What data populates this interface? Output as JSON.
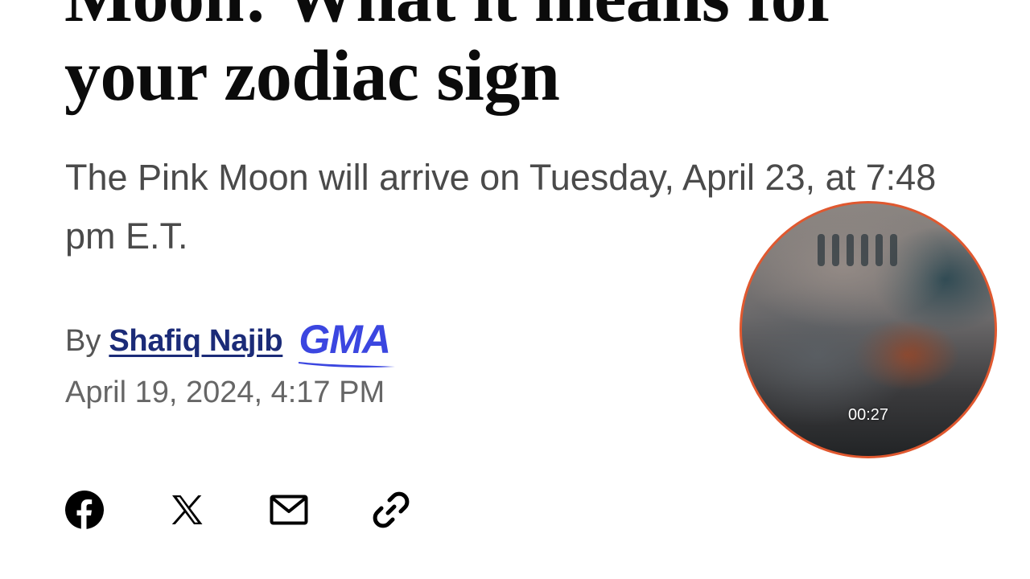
{
  "article": {
    "headline_lines": [
      "Moon: What it means for",
      "your zodiac sign"
    ],
    "subheadline": "The Pink Moon will arrive on Tuesday, April 23, at 7:48 pm E.T.",
    "byline": {
      "by_label": "By",
      "author": "Shafiq Najib",
      "brand": "GMA"
    },
    "date": "April 19, 2024, 4:17 PM"
  },
  "share": {
    "buttons": [
      {
        "icon": "facebook-icon"
      },
      {
        "icon": "x-icon"
      },
      {
        "icon": "mail-icon"
      },
      {
        "icon": "link-icon"
      }
    ]
  },
  "video": {
    "timestamp": "00:27",
    "border_color": "#e0582f"
  },
  "colors": {
    "headline": "#0b0b0b",
    "author_link": "#1b2b78",
    "brand": "#3b46e0",
    "meta_text": "#666666"
  }
}
